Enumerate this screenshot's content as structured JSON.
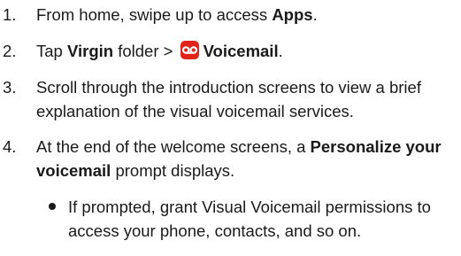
{
  "steps": [
    {
      "num": "1.",
      "text_before": "From home, swipe up to access ",
      "bold": "Apps",
      "text_after": "."
    },
    {
      "num": "2.",
      "text_before": "Tap ",
      "bold_folder": "Virgin",
      "mid": " folder > ",
      "icon": "voicemail-icon",
      "bold": "Voicemail",
      "text_after": "."
    },
    {
      "num": "3.",
      "text": "Scroll through the introduction screens to view a brief explanation of the visual voicemail services."
    },
    {
      "num": "4.",
      "text_before": "At the end of the welcome screens, a ",
      "bold": "Personalize your voicemail",
      "text_after": " prompt displays."
    }
  ],
  "bullet": {
    "text": "If prompted, grant Visual Voicemail permissions to access your phone, contacts, and so on."
  },
  "colors": {
    "icon_bg": "#e2231a",
    "text": "#1a1a1a"
  }
}
